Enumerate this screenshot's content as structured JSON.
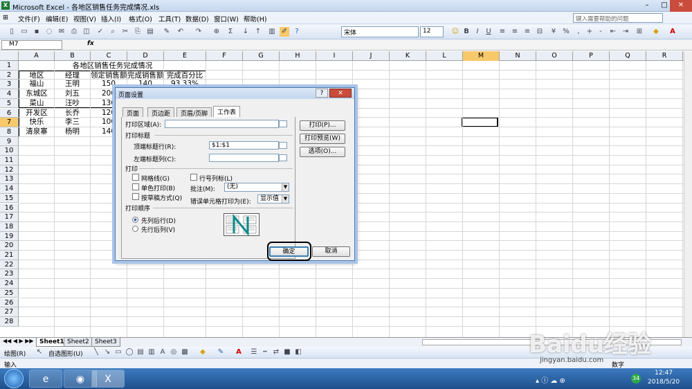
{
  "window": {
    "title": "Microsoft Excel - 各地区销售任务完成情况.xls"
  },
  "menu": [
    "文件(F)",
    "编辑(E)",
    "视图(V)",
    "插入(I)",
    "格式(O)",
    "工具(T)",
    "数据(D)",
    "窗口(W)",
    "帮助(H)"
  ],
  "help_placeholder": "键入需要帮助的问题",
  "font": {
    "name": "宋体",
    "size": "12"
  },
  "formula": {
    "cell_ref": "M7",
    "fx": "fx"
  },
  "columns": [
    "A",
    "B",
    "C",
    "D",
    "E",
    "F",
    "G",
    "H",
    "I",
    "J",
    "K",
    "L",
    "M",
    "N",
    "O",
    "P",
    "Q",
    "R"
  ],
  "rows": [
    "1",
    "2",
    "3",
    "4",
    "5",
    "6",
    "7",
    "8",
    "9",
    "10",
    "11",
    "12",
    "13",
    "14",
    "15",
    "16",
    "17",
    "18",
    "19",
    "20",
    "21",
    "22",
    "23",
    "24",
    "25",
    "26",
    "27",
    "28"
  ],
  "sheet": {
    "title": "各地区销售任务完成情况",
    "headers": [
      "地区",
      "经理",
      "领定销售额",
      "完成销售额",
      "完成百分比"
    ],
    "data": [
      [
        "福山",
        "王明",
        "150",
        "140",
        "93.33%"
      ],
      [
        "东城区",
        "刘五",
        "200",
        "",
        ""
      ],
      [
        "菜山",
        "汪吵",
        "130",
        "",
        ""
      ],
      [
        "开发区",
        "长乔",
        "120",
        "",
        ""
      ],
      [
        "快乐",
        "李三",
        "100",
        "",
        ""
      ],
      [
        "清泉寨",
        "杨明",
        "140",
        "",
        ""
      ]
    ]
  },
  "sheet_tabs": [
    "Sheet1",
    "Sheet2",
    "Sheet3"
  ],
  "drawbar": {
    "draw": "绘图(R)",
    "autoshape": "自选图形(U)"
  },
  "status": {
    "mode": "输入",
    "right": "数字"
  },
  "clock": {
    "time": "12:47",
    "date": "2018/5/20"
  },
  "tray_badge": "34",
  "watermark": {
    "brand": "Baidu经验",
    "url": "jingyan.baidu.com"
  },
  "dialog": {
    "title": "页面设置",
    "tabs": [
      "页面",
      "页边距",
      "页眉/页脚",
      "工作表"
    ],
    "active_tab": "工作表",
    "print_area_label": "打印区域(A):",
    "print_titles_label": "打印标题",
    "top_rows_label": "顶端标题行(R):",
    "top_rows_value": "$1:$1",
    "left_cols_label": "左端标题列(C):",
    "print_label": "打印",
    "gridlines_label": "网格线(G)",
    "mono_label": "单色打印(B)",
    "draft_label": "按草稿方式(Q)",
    "rowcol_label": "行号列标(L)",
    "comments_label": "批注(M):",
    "comments_value": "(无)",
    "errors_label": "错误单元格打印为(E):",
    "errors_value": "显示值",
    "order_label": "打印顺序",
    "down_over_label": "先列后行(D)",
    "over_down_label": "先行后列(V)",
    "print_btn": "打印(P)...",
    "preview_btn": "打印预览(W)",
    "options_btn": "选项(O)...",
    "ok_btn": "确定",
    "cancel_btn": "取消"
  }
}
